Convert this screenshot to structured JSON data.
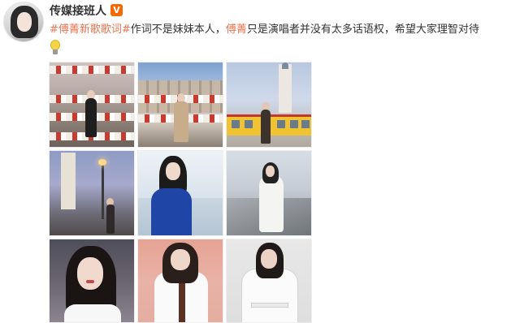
{
  "post": {
    "username": "传媒接班人",
    "verified_badge": "V",
    "text": {
      "hashtag": "#傅菁新歌歌词#",
      "part1": "作词不是妹妹本人，",
      "name": "傅菁",
      "part2": "只是演唱者并没有太多话语权，希望大家理智对待"
    },
    "emoji_icon": "lightbulb-icon"
  },
  "photos": [
    {
      "subject": "photo-street-collage"
    },
    {
      "subject": "photo-street-beige-coat"
    },
    {
      "subject": "photo-yellow-tram"
    },
    {
      "subject": "photo-evening-street"
    },
    {
      "subject": "photo-blue-coat-seaside"
    },
    {
      "subject": "photo-white-coat-pier"
    },
    {
      "subject": "photo-closeup-portrait"
    },
    {
      "subject": "photo-white-shirt-tie"
    },
    {
      "subject": "photo-white-robe"
    }
  ],
  "colors": {
    "accent": "#eb7350",
    "verified": "#f56a00",
    "text": "#333333"
  }
}
